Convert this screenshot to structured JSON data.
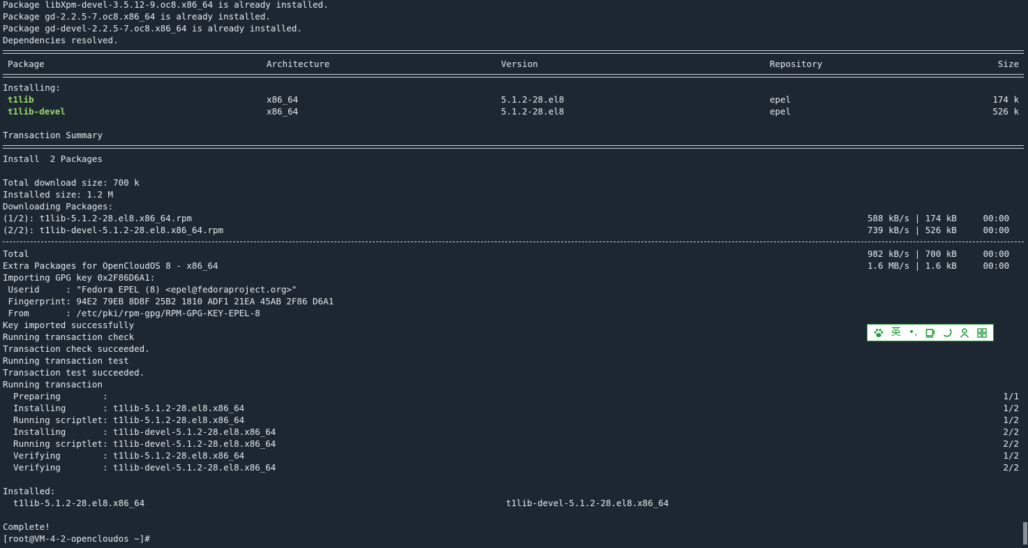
{
  "pre_lines": [
    "Package libXpm-devel-3.5.12-9.oc8.x86_64 is already installed.",
    "Package gd-2.2.5-7.oc8.x86_64 is already installed.",
    "Package gd-devel-2.2.5-7.oc8.x86_64 is already installed.",
    "Dependencies resolved."
  ],
  "table": {
    "headers": [
      "Package",
      "Architecture",
      "Version",
      "Repository",
      "Size"
    ],
    "section": "Installing:",
    "rows": [
      {
        "package": "t1lib",
        "arch": "x86_64",
        "version": "5.1.2-28.el8",
        "repo": "epel",
        "size": "174 k"
      },
      {
        "package": "t1lib-devel",
        "arch": "x86_64",
        "version": "5.1.2-28.el8",
        "repo": "epel",
        "size": "526 k"
      }
    ]
  },
  "transaction_summary": "Transaction Summary",
  "install_line": "Install  2 Packages",
  "sizes": [
    "Total download size: 700 k",
    "Installed size: 1.2 M",
    "Downloading Packages:"
  ],
  "downloads": [
    {
      "name": "(1/2): t1lib-5.1.2-28.el8.x86_64.rpm",
      "stats": "588 kB/s | 174 kB     00:00"
    },
    {
      "name": "(2/2): t1lib-devel-5.1.2-28.el8.x86_64.rpm",
      "stats": "739 kB/s | 526 kB     00:00"
    }
  ],
  "totals": [
    {
      "name": "Total",
      "stats": "982 kB/s | 700 kB     00:00"
    },
    {
      "name": "Extra Packages for OpenCloudOS 8 - x86_64",
      "stats": "1.6 MB/s | 1.6 kB     00:00"
    }
  ],
  "gpg_lines": [
    "Importing GPG key 0x2F86D6A1:",
    " Userid     : \"Fedora EPEL (8) <epel@fedoraproject.org>\"",
    " Fingerprint: 94E2 79EB 8D8F 25B2 1810 ADF1 21EA 45AB 2F86 D6A1",
    " From       : /etc/pki/rpm-gpg/RPM-GPG-KEY-EPEL-8",
    "Key imported successfully",
    "Running transaction check",
    "Transaction check succeeded.",
    "Running transaction test",
    "Transaction test succeeded.",
    "Running transaction"
  ],
  "steps": [
    {
      "text": "  Preparing        :",
      "count": "1/1"
    },
    {
      "text": "  Installing       : t1lib-5.1.2-28.el8.x86_64",
      "count": "1/2"
    },
    {
      "text": "  Running scriptlet: t1lib-5.1.2-28.el8.x86_64",
      "count": "1/2"
    },
    {
      "text": "  Installing       : t1lib-devel-5.1.2-28.el8.x86_64",
      "count": "2/2"
    },
    {
      "text": "  Running scriptlet: t1lib-devel-5.1.2-28.el8.x86_64",
      "count": "2/2"
    },
    {
      "text": "  Verifying        : t1lib-5.1.2-28.el8.x86_64",
      "count": "1/2"
    },
    {
      "text": "  Verifying        : t1lib-devel-5.1.2-28.el8.x86_64",
      "count": "2/2"
    }
  ],
  "installed_label": "Installed:",
  "installed_items": [
    "  t1lib-5.1.2-28.el8.x86_64",
    "t1lib-devel-5.1.2-28.el8.x86_64"
  ],
  "complete": "Complete!",
  "prompt": "[root@VM-4-2-opencloudos ~]#",
  "ime_toolbar": {
    "lang_label": "英",
    "punct_label": "•,",
    "icons": [
      "paw-icon",
      "cup-icon",
      "moon-icon",
      "user-icon",
      "grid-icon"
    ]
  },
  "colors": {
    "background": "#1c2731",
    "text": "#e6ebef",
    "package_highlight": "#9cd86a",
    "ime_accent": "#1f9a3a"
  }
}
